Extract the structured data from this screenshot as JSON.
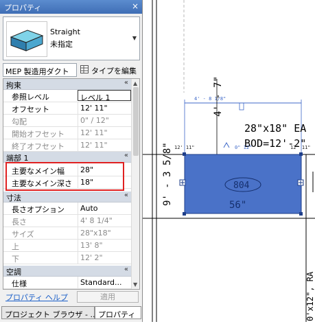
{
  "palette": {
    "title": "プロパティ",
    "close": "×",
    "type_selector": {
      "line1": "Straight",
      "line2": "未指定"
    },
    "family_select": "MEP 製造用ダクト",
    "edit_type": "タイプを編集",
    "sections": [
      {
        "label": "拘束",
        "collapse": "«"
      },
      {
        "label": "端部 1",
        "collapse": "«"
      },
      {
        "label": "寸法",
        "collapse": "«"
      },
      {
        "label": "空調",
        "collapse": "«"
      }
    ],
    "constraints": [
      {
        "name": "参照レベル",
        "value": "レベル 1"
      },
      {
        "name": "オフセット",
        "value": "12'  11\""
      },
      {
        "name": "勾配",
        "value": "0\" / 12\""
      },
      {
        "name": "開始オフセット",
        "value": "12'  11\""
      },
      {
        "name": "終了オフセット",
        "value": "12'  11\""
      }
    ],
    "end1": [
      {
        "name": "主要なメイン幅",
        "value": "28\""
      },
      {
        "name": "主要なメイン深さ",
        "value": "18\""
      }
    ],
    "dimensions": [
      {
        "name": "長さオプション",
        "value": "Auto"
      },
      {
        "name": "長さ",
        "value": "4'  8 1/4\""
      },
      {
        "name": "サイズ",
        "value": "28\"x18\""
      },
      {
        "name": "上",
        "value": "13'  8\""
      },
      {
        "name": "下",
        "value": "12'  2\""
      }
    ],
    "hvac": [
      {
        "name": "仕様",
        "value": "Standard..."
      }
    ],
    "help_link": "プロパティ ヘルプ",
    "apply": "適用",
    "tabs": [
      "プロジェクト ブラウザ - ...",
      "プロパティ"
    ]
  },
  "drawing": {
    "dim_top": "4' - 8 1/8\"",
    "dim_vertical_top": "4' - 7\"",
    "tag_size": "28\"x18\" EA",
    "tag_bod": "BOD=12'-2\"",
    "dim_left_vertical": "9' - 3 5/8\"",
    "elev_left": "12' 11\"",
    "elev_mid": "0\" 12\"",
    "elev_right": "12' 11\"",
    "duct_tag": "804",
    "duct_depth": "56\"",
    "right_bottom_vertical": "0'x12\", RA",
    "fill_color": "#4a72c8"
  }
}
